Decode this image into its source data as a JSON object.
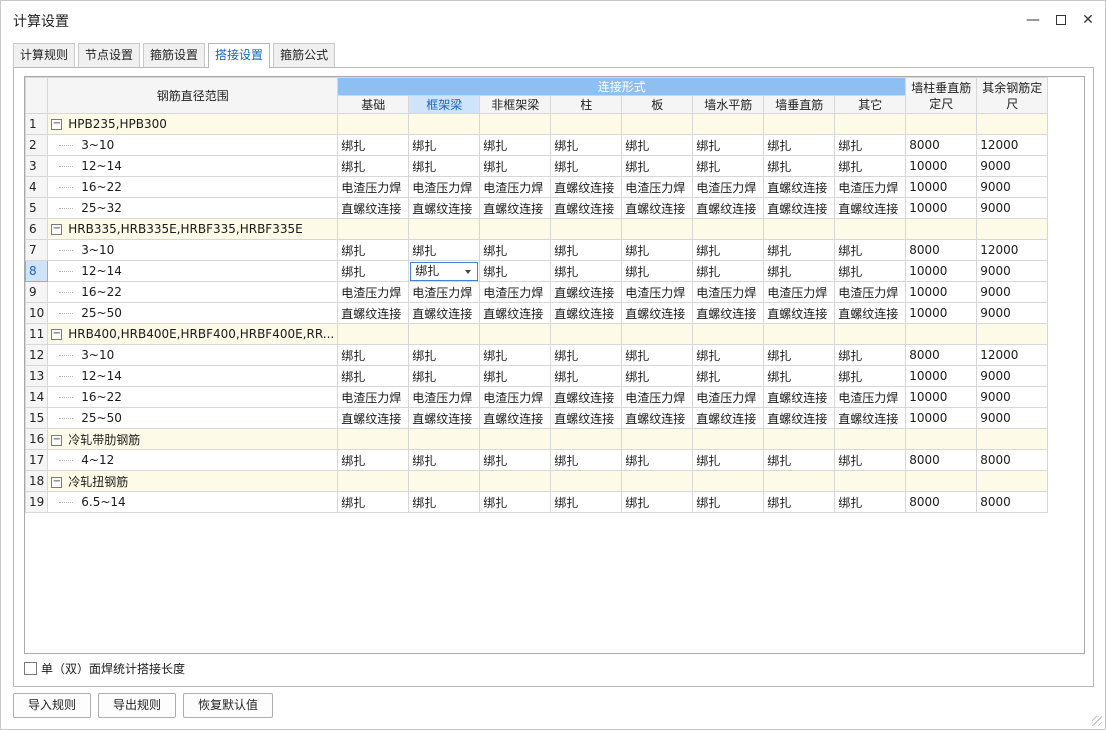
{
  "window": {
    "title": "计算设置",
    "min_icon": "minimize-icon",
    "max_icon": "maximize-icon",
    "close_icon": "close-icon"
  },
  "tabs": [
    {
      "label": "计算规则",
      "active": false
    },
    {
      "label": "节点设置",
      "active": false
    },
    {
      "label": "箍筋设置",
      "active": false
    },
    {
      "label": "搭接设置",
      "active": true
    },
    {
      "label": "箍筋公式",
      "active": false
    }
  ],
  "grid": {
    "header_range": "钢筋直径范围",
    "header_group": "连接形式",
    "connection_columns": [
      "基础",
      "框架梁",
      "非框架梁",
      "柱",
      "板",
      "墙水平筋",
      "墙垂直筋",
      "其它"
    ],
    "selected_column": 1,
    "header_wall_len": "墙柱垂直筋定尺",
    "header_other_len": "其余钢筋定尺",
    "selected_row": 8,
    "rows": [
      {
        "num": "1",
        "group": true,
        "label": "HPB235,HPB300"
      },
      {
        "num": "2",
        "label": "3~10",
        "cells": [
          "绑扎",
          "绑扎",
          "绑扎",
          "绑扎",
          "绑扎",
          "绑扎",
          "绑扎",
          "绑扎"
        ],
        "wall_len": "8000",
        "other_len": "12000"
      },
      {
        "num": "3",
        "label": "12~14",
        "cells": [
          "绑扎",
          "绑扎",
          "绑扎",
          "绑扎",
          "绑扎",
          "绑扎",
          "绑扎",
          "绑扎"
        ],
        "wall_len": "10000",
        "other_len": "9000"
      },
      {
        "num": "4",
        "label": "16~22",
        "cells": [
          "电渣压力焊",
          "电渣压力焊",
          "电渣压力焊",
          "直螺纹连接",
          "电渣压力焊",
          "电渣压力焊",
          "直螺纹连接",
          "电渣压力焊"
        ],
        "wall_len": "10000",
        "other_len": "9000"
      },
      {
        "num": "5",
        "label": "25~32",
        "cells": [
          "直螺纹连接",
          "直螺纹连接",
          "直螺纹连接",
          "直螺纹连接",
          "直螺纹连接",
          "直螺纹连接",
          "直螺纹连接",
          "直螺纹连接"
        ],
        "wall_len": "10000",
        "other_len": "9000"
      },
      {
        "num": "6",
        "group": true,
        "label": "HRB335,HRB335E,HRBF335,HRBF335E"
      },
      {
        "num": "7",
        "label": "3~10",
        "cells": [
          "绑扎",
          "绑扎",
          "绑扎",
          "绑扎",
          "绑扎",
          "绑扎",
          "绑扎",
          "绑扎"
        ],
        "wall_len": "8000",
        "other_len": "12000"
      },
      {
        "num": "8",
        "label": "12~14",
        "cells": [
          "绑扎",
          "绑扎",
          "绑扎",
          "绑扎",
          "绑扎",
          "绑扎",
          "绑扎",
          "绑扎"
        ],
        "wall_len": "10000",
        "other_len": "9000"
      },
      {
        "num": "9",
        "label": "16~22",
        "cells": [
          "电渣压力焊",
          "电渣压力焊",
          "电渣压力焊",
          "直螺纹连接",
          "电渣压力焊",
          "电渣压力焊",
          "电渣压力焊",
          "电渣压力焊"
        ],
        "wall_len": "10000",
        "other_len": "9000"
      },
      {
        "num": "10",
        "label": "25~50",
        "cells": [
          "直螺纹连接",
          "直螺纹连接",
          "直螺纹连接",
          "直螺纹连接",
          "直螺纹连接",
          "直螺纹连接",
          "直螺纹连接",
          "直螺纹连接"
        ],
        "wall_len": "10000",
        "other_len": "9000"
      },
      {
        "num": "11",
        "group": true,
        "label": "HRB400,HRB400E,HRBF400,HRBF400E,RR..."
      },
      {
        "num": "12",
        "label": "3~10",
        "cells": [
          "绑扎",
          "绑扎",
          "绑扎",
          "绑扎",
          "绑扎",
          "绑扎",
          "绑扎",
          "绑扎"
        ],
        "wall_len": "8000",
        "other_len": "12000"
      },
      {
        "num": "13",
        "label": "12~14",
        "cells": [
          "绑扎",
          "绑扎",
          "绑扎",
          "绑扎",
          "绑扎",
          "绑扎",
          "绑扎",
          "绑扎"
        ],
        "wall_len": "10000",
        "other_len": "9000"
      },
      {
        "num": "14",
        "label": "16~22",
        "cells": [
          "电渣压力焊",
          "电渣压力焊",
          "电渣压力焊",
          "直螺纹连接",
          "电渣压力焊",
          "电渣压力焊",
          "直螺纹连接",
          "电渣压力焊"
        ],
        "wall_len": "10000",
        "other_len": "9000"
      },
      {
        "num": "15",
        "label": "25~50",
        "cells": [
          "直螺纹连接",
          "直螺纹连接",
          "直螺纹连接",
          "直螺纹连接",
          "直螺纹连接",
          "直螺纹连接",
          "直螺纹连接",
          "直螺纹连接"
        ],
        "wall_len": "10000",
        "other_len": "9000"
      },
      {
        "num": "16",
        "group": true,
        "label": "冷轧带肋钢筋"
      },
      {
        "num": "17",
        "label": "4~12",
        "cells": [
          "绑扎",
          "绑扎",
          "绑扎",
          "绑扎",
          "绑扎",
          "绑扎",
          "绑扎",
          "绑扎"
        ],
        "wall_len": "8000",
        "other_len": "8000"
      },
      {
        "num": "18",
        "group": true,
        "label": "冷轧扭钢筋"
      },
      {
        "num": "19",
        "label": "6.5~14",
        "cells": [
          "绑扎",
          "绑扎",
          "绑扎",
          "绑扎",
          "绑扎",
          "绑扎",
          "绑扎",
          "绑扎"
        ],
        "wall_len": "8000",
        "other_len": "8000"
      }
    ]
  },
  "options": {
    "checkbox_label": "单（双）面焊统计搭接长度",
    "checked": false
  },
  "buttons": {
    "import": "导入规则",
    "export": "导出规则",
    "reset": "恢复默认值"
  },
  "colors": {
    "accent": "#1565c0",
    "header_group_bg": "#8ebff2",
    "group_row_bg": "#fdfbe7",
    "selection_bg": "#cfe3fb"
  }
}
